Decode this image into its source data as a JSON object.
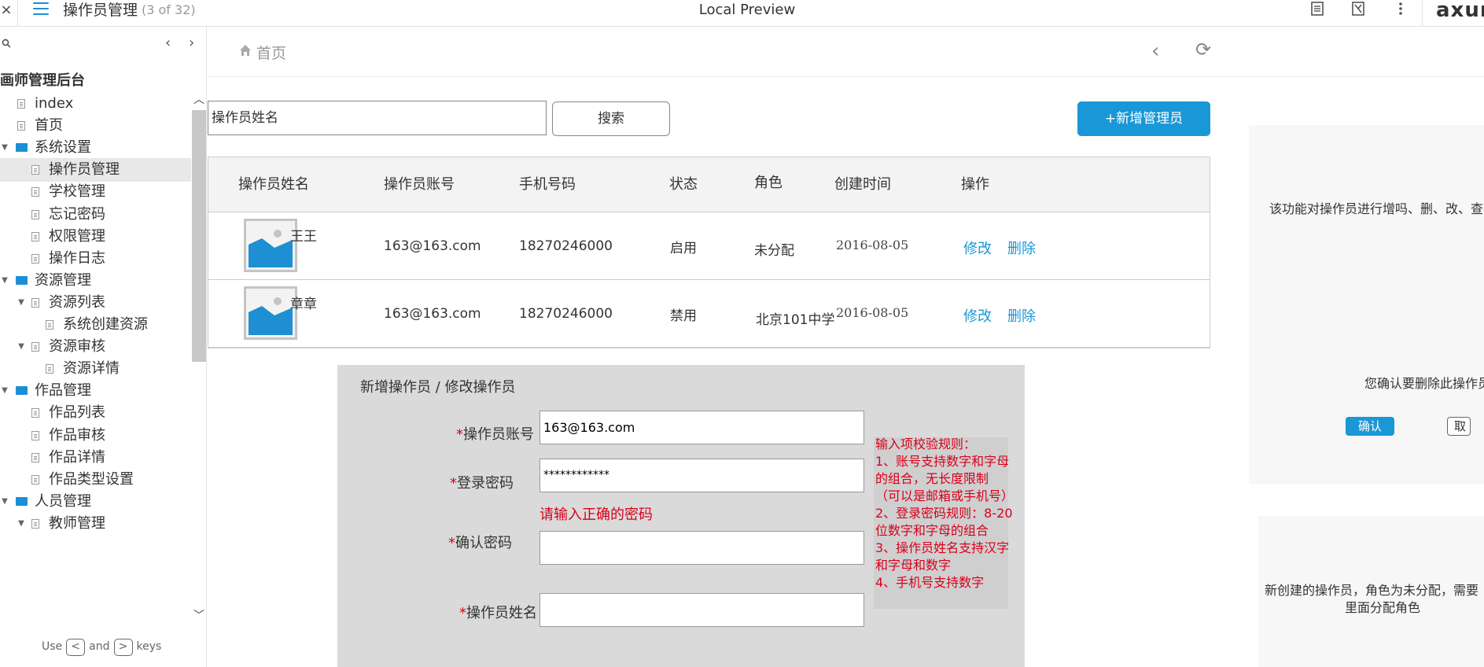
{
  "topbar": {
    "close_label": "×",
    "page_name": "操作员管理",
    "page_count": "(3 of 32)",
    "center_title": "Local Preview",
    "brand": "axure"
  },
  "sidebar": {
    "tree_title": "画师管理后台",
    "items": [
      {
        "label": "index",
        "kind": "doc",
        "depth": 0
      },
      {
        "label": "首页",
        "kind": "doc",
        "depth": 0
      },
      {
        "label": "系统设置",
        "kind": "folder",
        "depth": 0
      },
      {
        "label": "操作员管理",
        "kind": "doc",
        "depth": 1,
        "active": true
      },
      {
        "label": "学校管理",
        "kind": "doc",
        "depth": 1
      },
      {
        "label": "忘记密码",
        "kind": "doc",
        "depth": 1
      },
      {
        "label": "权限管理",
        "kind": "doc",
        "depth": 1
      },
      {
        "label": "操作日志",
        "kind": "doc",
        "depth": 1
      },
      {
        "label": "资源管理",
        "kind": "folder",
        "depth": 0
      },
      {
        "label": "资源列表",
        "kind": "doc",
        "depth": 1,
        "expanded": true
      },
      {
        "label": "系统创建资源",
        "kind": "doc",
        "depth": 2
      },
      {
        "label": "资源审核",
        "kind": "doc",
        "depth": 1,
        "expanded": true
      },
      {
        "label": "资源详情",
        "kind": "doc",
        "depth": 2
      },
      {
        "label": "作品管理",
        "kind": "folder",
        "depth": 0
      },
      {
        "label": "作品列表",
        "kind": "doc",
        "depth": 1
      },
      {
        "label": "作品审核",
        "kind": "doc",
        "depth": 1
      },
      {
        "label": "作品详情",
        "kind": "doc",
        "depth": 1
      },
      {
        "label": "作品类型设置",
        "kind": "doc",
        "depth": 1
      },
      {
        "label": "人员管理",
        "kind": "folder",
        "depth": 0
      },
      {
        "label": "教师管理",
        "kind": "doc",
        "depth": 1,
        "expanded": true
      }
    ],
    "hint_use": "Use",
    "hint_key_left": "<",
    "hint_and": "and",
    "hint_key_right": ">",
    "hint_keys": "keys"
  },
  "breadcrumb": {
    "home": "首页"
  },
  "search": {
    "placeholder": "操作员姓名",
    "button": "搜索"
  },
  "add_button": "+新增管理员",
  "table": {
    "headers": [
      "操作员姓名",
      "操作员账号",
      "手机号码",
      "状态",
      "角色",
      "创建时间",
      "操作"
    ],
    "rows": [
      {
        "name": "王王",
        "account": "163@163.com",
        "phone": "18270246000",
        "status": "启用",
        "role": "未分配",
        "created": "2016-08-05",
        "edit": "修改",
        "delete": "删除"
      },
      {
        "name": "章章",
        "account": "163@163.com",
        "phone": "18270246000",
        "status": "禁用",
        "role": "北京101中学",
        "created": "2016-08-05",
        "edit": "修改",
        "delete": "删除"
      }
    ]
  },
  "form": {
    "title": "新增操作员 / 修改操作员",
    "required_mark": "*",
    "account_label": "操作员账号",
    "account_value": "163@163.com",
    "password_label": "登录密码",
    "password_value": "************",
    "password_error": "请输入正确的密码",
    "confirm_label": "确认密码",
    "confirm_value": "",
    "name_label": "操作员姓名",
    "name_value": "",
    "rules": [
      "输入项校验规则：",
      "1、账号支持数字和字母的组合，无长度限制（可以是邮箱或手机号）",
      "2、登录密码规则：8-20位数字和字母的组合",
      "3、操作员姓名支持汉字和字母和数字",
      "4、手机号支持数字"
    ]
  },
  "notes": {
    "function_note": "该功能对操作员进行增吗、删、改、查",
    "delete_confirm": "您确认要删除此操作员",
    "confirm_button": "确认",
    "cancel_button": "取",
    "new_operator_line1": "新创建的操作员，角色为未分配，需要",
    "new_operator_line2": "里面分配角色"
  },
  "colors": {
    "accent": "#1a97d6",
    "error": "#d9001b",
    "folder": "#1a8fd6"
  }
}
